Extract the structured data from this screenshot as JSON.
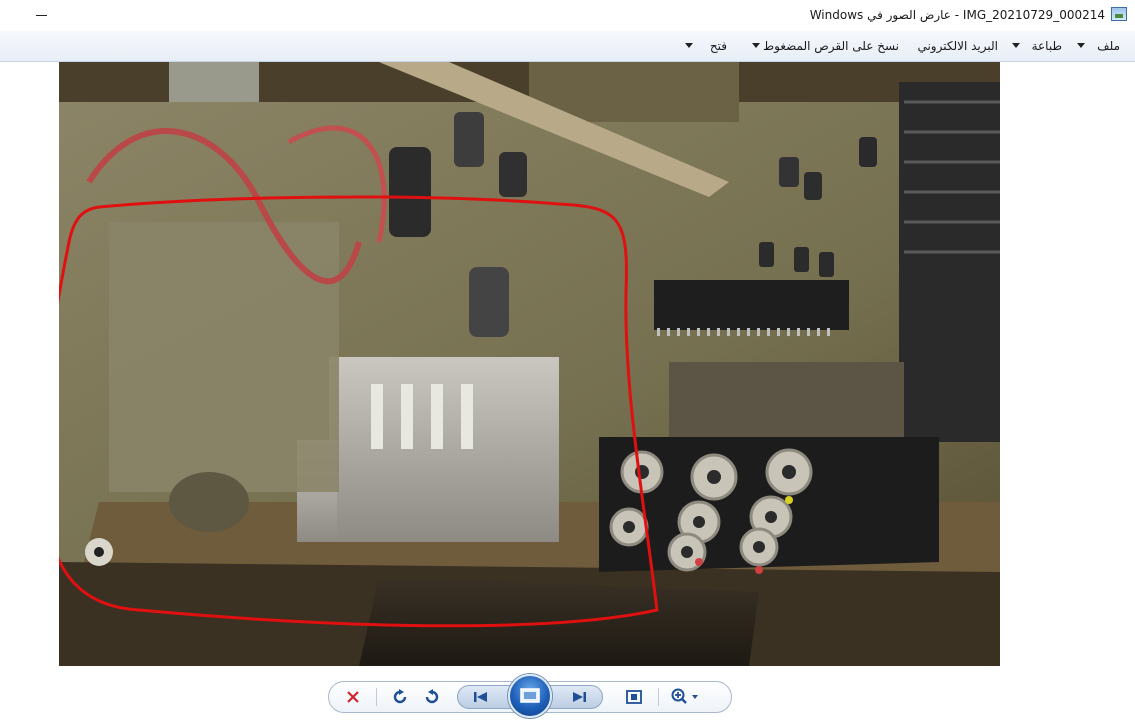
{
  "window": {
    "title": "IMG_20210729_000214 - عارض الصور في Windows",
    "app_icon": "photo-viewer-icon"
  },
  "menu": {
    "items": [
      {
        "label": "ملف",
        "has_dropdown": true
      },
      {
        "label": "طباعة",
        "has_dropdown": true
      },
      {
        "label": "البريد الالكتروني",
        "has_dropdown": false
      },
      {
        "label": "نسخ على القرص المضغوط",
        "has_dropdown": false
      },
      {
        "label": "فتح",
        "has_dropdown": true
      }
    ]
  },
  "image": {
    "alt_subject": "circuit-board-photo",
    "annotation_color": "#e01010"
  },
  "toolbar": {
    "buttons": [
      {
        "name": "delete-icon",
        "glyph": "✕",
        "color": "#d0262a"
      },
      {
        "name": "rotate-clockwise-icon",
        "glyph": "↻",
        "color": "#1f4f96"
      },
      {
        "name": "rotate-counterclockwise-icon",
        "glyph": "↺",
        "color": "#1f4f96"
      },
      {
        "name": "previous-icon",
        "glyph": "⏮",
        "color": "#1f4f96"
      },
      {
        "name": "slideshow-icon",
        "glyph": "▣",
        "color": "#ffffff"
      },
      {
        "name": "next-icon",
        "glyph": "⏭",
        "color": "#1f4f96"
      },
      {
        "name": "actual-size-icon",
        "glyph": "⛶",
        "color": "#1f4f96"
      },
      {
        "name": "zoom-icon",
        "glyph": "⊕",
        "color": "#1f4f96"
      }
    ]
  }
}
